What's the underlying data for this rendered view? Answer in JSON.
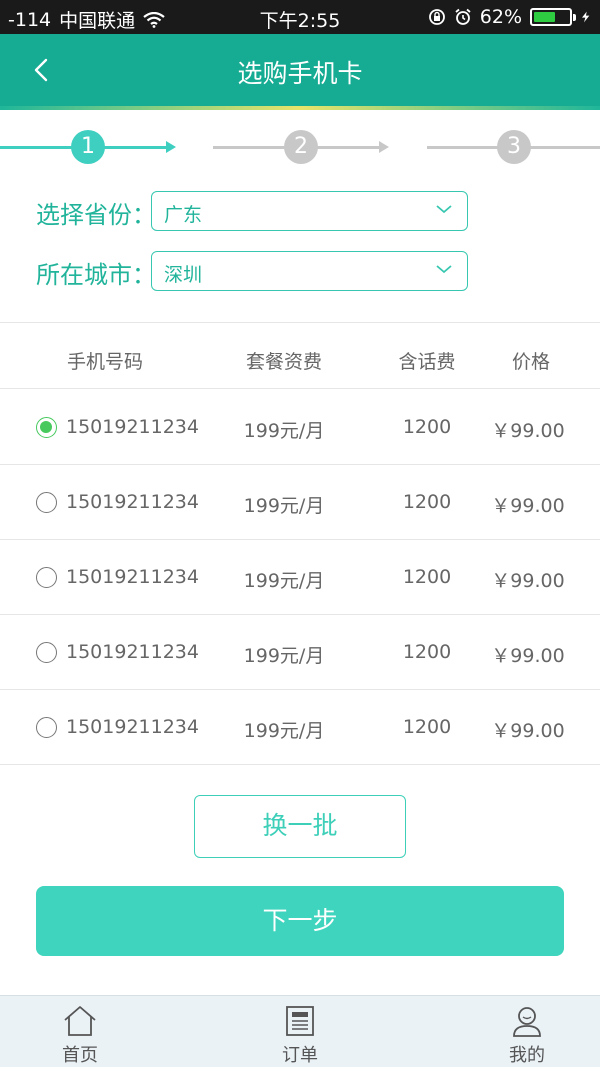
{
  "status_bar": {
    "signal": "-114",
    "carrier": "中国联通",
    "time": "下午2:55",
    "battery_percent": "62%",
    "battery_level": 0.62
  },
  "header": {
    "title": "选购手机卡"
  },
  "stepper": {
    "steps": [
      "1",
      "2",
      "3"
    ],
    "current": 1,
    "active_color": "#3ecfc0",
    "inactive_color": "#c8c8c8"
  },
  "form": {
    "province": {
      "label": "选择省份：",
      "value": "广东"
    },
    "city": {
      "label": "所在城市：",
      "value": "深圳"
    }
  },
  "table": {
    "headers": [
      "手机号码",
      "套餐资费",
      "含话费",
      "价格"
    ],
    "rows": [
      {
        "number": "15019211234",
        "plan": "199元/月",
        "credit": "1200",
        "price": "￥99.00",
        "selected": true
      },
      {
        "number": "15019211234",
        "plan": "199元/月",
        "credit": "1200",
        "price": "￥99.00",
        "selected": false
      },
      {
        "number": "15019211234",
        "plan": "199元/月",
        "credit": "1200",
        "price": "￥99.00",
        "selected": false
      },
      {
        "number": "15019211234",
        "plan": "199元/月",
        "credit": "1200",
        "price": "￥99.00",
        "selected": false
      },
      {
        "number": "15019211234",
        "plan": "199元/月",
        "credit": "1200",
        "price": "￥99.00",
        "selected": false
      }
    ]
  },
  "buttons": {
    "refresh": "换一批",
    "next": "下一步"
  },
  "tabbar": {
    "items": [
      {
        "label": "首页",
        "icon": "home-icon"
      },
      {
        "label": "订单",
        "icon": "orders-icon"
      },
      {
        "label": "我的",
        "icon": "profile-icon"
      }
    ]
  },
  "colors": {
    "header": "#16ab93",
    "accent": "#3fd4bd",
    "radio_checked": "#47c95d"
  }
}
